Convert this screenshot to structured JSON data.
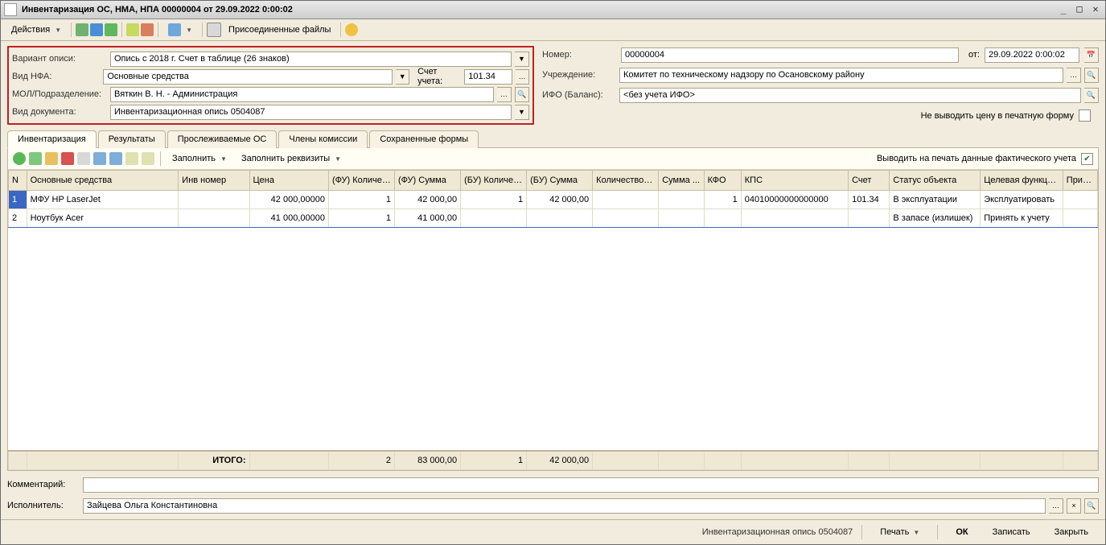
{
  "window": {
    "title": "Инвентаризация ОС, НМА, НПА 00000004 от 29.09.2022 0:00:02"
  },
  "toolbar": {
    "actions": "Действия",
    "attached": "Присоединенные файлы"
  },
  "form": {
    "leftLabels": {
      "opis": "Вариант описи:",
      "nfa": "Вид НФА:",
      "mol": "МОЛ/Подразделение:",
      "doc": "Вид документа:",
      "acct": "Счет учета:"
    },
    "left": {
      "opis": "Опись с 2018 г. Счет в таблице (26 знаков)",
      "nfa": "Основные средства",
      "acct": "101.34",
      "mol": "Вяткин В. Н. - Администрация",
      "doc": "Инвентаризационная опись 0504087"
    },
    "rightLabels": {
      "num": "Номер:",
      "from": "от:",
      "org": "Учреждение:",
      "ifo": "ИФО (Баланс):"
    },
    "right": {
      "num": "00000004",
      "date": "29.09.2022  0:00:02",
      "org": "Комитет по техническому надзору по Осановскому району",
      "ifo": "<без учета ИФО>"
    },
    "noPrintPrice": "Не выводить цену в печатную форму"
  },
  "tabs": [
    "Инвентаризация",
    "Результаты",
    "Прослеживаемые ОС",
    "Члены комиссии",
    "Сохраненные формы"
  ],
  "gridbar": {
    "fill": "Заполнить",
    "fillReq": "Заполнить реквизиты",
    "printFact": "Выводить на печать данные фактического учета"
  },
  "columns": [
    "N",
    "Основные средства",
    "Инв номер",
    "Цена",
    "(ФУ) Количес...",
    "(ФУ) Сумма",
    "(БУ) Количест...",
    "(БУ) Сумма",
    "Количество н...",
    "Сумма ...",
    "КФО",
    "КПС",
    "Счет",
    "Статус объекта",
    "Целевая функци...",
    "Прим..."
  ],
  "rows": [
    {
      "n": "1",
      "os": "МФУ HP LaserJet",
      "inv": "",
      "price": "42 000,00000",
      "fuq": "1",
      "fus": "42 000,00",
      "buq": "1",
      "bus": "42 000,00",
      "qn": "",
      "sn": "",
      "kfo": "1",
      "kps": "04010000000000000",
      "acct": "101.34",
      "status": "В эксплуатации",
      "func": "Эксплуатировать",
      "note": ""
    },
    {
      "n": "2",
      "os": "Ноутбук Acer",
      "inv": "",
      "price": "41 000,00000",
      "fuq": "1",
      "fus": "41 000,00",
      "buq": "",
      "bus": "",
      "qn": "",
      "sn": "",
      "kfo": "",
      "kps": "",
      "acct": "",
      "status": "В запасе (излишек)",
      "func": "Принять к учету",
      "note": ""
    }
  ],
  "totals": {
    "label": "ИТОГО:",
    "fuq": "2",
    "fus": "83 000,00",
    "buq": "1",
    "bus": "42 000,00"
  },
  "bottom": {
    "commentLbl": "Комментарий:",
    "comment": "",
    "execLbl": "Исполнитель:",
    "exec": "Зайцева Ольга Константиновна"
  },
  "status": {
    "doc": "Инвентаризационная опись 0504087",
    "print": "Печать",
    "ok": "ОК",
    "save": "Записать",
    "close": "Закрыть"
  }
}
